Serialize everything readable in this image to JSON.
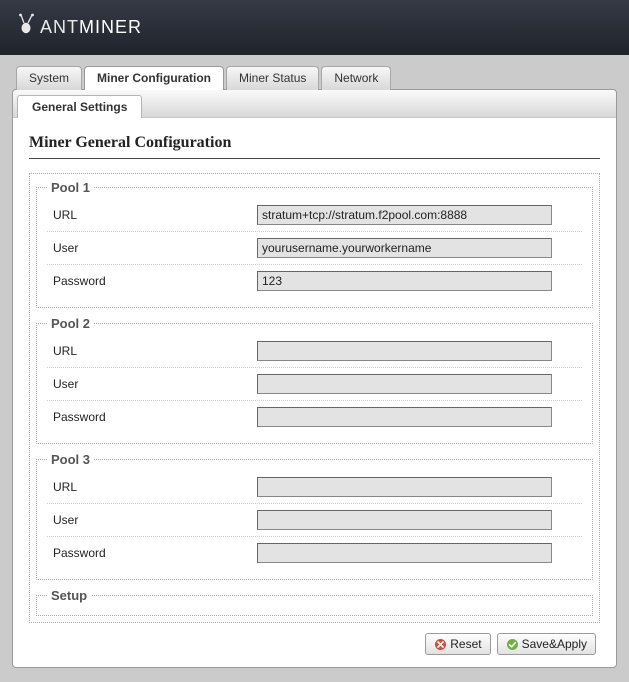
{
  "brand": {
    "name_light": "ANT",
    "name_bold": "MINER"
  },
  "tabs": [
    {
      "label": "System"
    },
    {
      "label": "Miner Configuration"
    },
    {
      "label": "Miner Status"
    },
    {
      "label": "Network"
    }
  ],
  "subtab": {
    "label": "General Settings"
  },
  "page_title": "Miner General Configuration",
  "pools": [
    {
      "legend": "Pool 1",
      "url_label": "URL",
      "user_label": "User",
      "password_label": "Password",
      "url": "stratum+tcp://stratum.f2pool.com:8888",
      "user": "yourusername.yourworkername",
      "password": "123"
    },
    {
      "legend": "Pool 2",
      "url_label": "URL",
      "user_label": "User",
      "password_label": "Password",
      "url": "",
      "user": "",
      "password": ""
    },
    {
      "legend": "Pool 3",
      "url_label": "URL",
      "user_label": "User",
      "password_label": "Password",
      "url": "",
      "user": "",
      "password": ""
    }
  ],
  "setup": {
    "legend": "Setup"
  },
  "buttons": {
    "reset": "Reset",
    "save_apply": "Save&Apply"
  }
}
